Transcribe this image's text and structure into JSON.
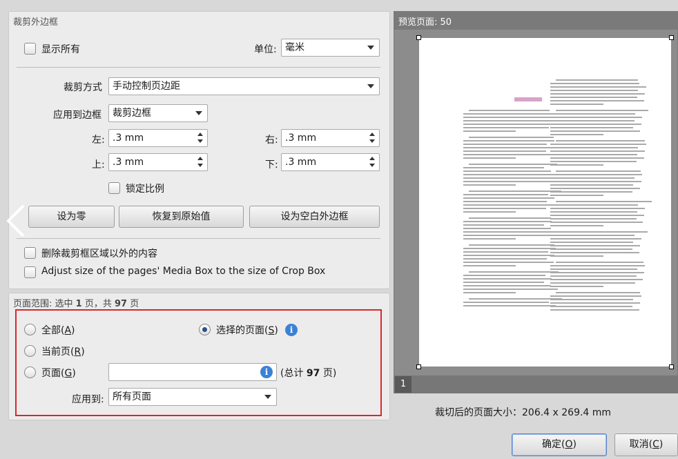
{
  "crop_section": {
    "title": "裁剪外边框",
    "show_all_label": "显示所有",
    "unit_label": "单位:",
    "unit_value": "毫米",
    "crop_mode_label": "裁剪方式",
    "crop_mode_value": "手动控制页边距",
    "apply_to_box_label": "应用到边框",
    "apply_to_box_value": "裁剪边框",
    "left_label": "左:",
    "left_value": ".3 mm",
    "right_label": "右:",
    "right_value": ".3 mm",
    "top_label": "上:",
    "top_value": ".3 mm",
    "bottom_label": "下:",
    "bottom_value": ".3 mm",
    "lock_ratio_label": "锁定比例",
    "set_zero_label": "设为零",
    "restore_label": "恢复到原始值",
    "set_blank_label": "设为空白外边框",
    "delete_outside_label": "删除裁剪框区域以外的内容",
    "adjust_media_label": "Adjust size of the pages' Media Box to the size of Crop Box"
  },
  "range_section": {
    "title_prefix": "页面范围: 选中 ",
    "selected_count": "1",
    "title_mid": " 页，共 ",
    "total_count": "97",
    "title_suffix": " 页",
    "all_label": "全部",
    "all_key": "A",
    "selected_pages_label": "选择的页面",
    "selected_pages_key": "S",
    "current_page_label": "当前页",
    "current_page_key": "R",
    "pages_label": "页面",
    "pages_key": "G",
    "pages_input_value": "",
    "total_prefix": "(总计 ",
    "total_value": "97",
    "total_suffix": " 页)",
    "apply_to_label": "应用到:",
    "apply_to_value": "所有页面",
    "info_icon_text": "i",
    "highlight_color": "#d9262c"
  },
  "preview": {
    "title": "预览页面: 50",
    "page_number": "1",
    "size_text": "裁切后的页面大小：206.4 x 269.4 mm"
  },
  "footer": {
    "ok_label": "确定",
    "ok_key": "O",
    "cancel_label": "取消",
    "cancel_key": "C"
  },
  "colors": {
    "accent": "#3b82d6",
    "preview_bg": "#8c8c8c",
    "preview_header": "#7a7a7a"
  }
}
